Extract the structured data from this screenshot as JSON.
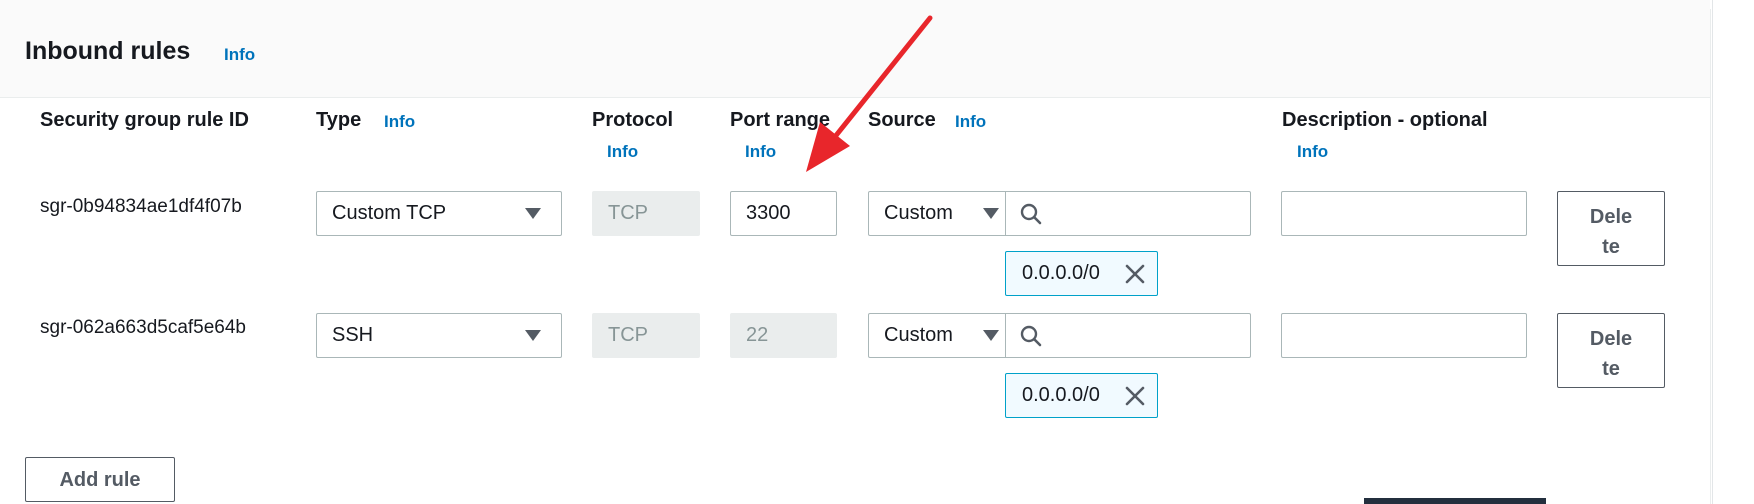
{
  "section": {
    "title": "Inbound rules",
    "info": "Info"
  },
  "columns": {
    "rule_id": "Security group rule ID",
    "type": "Type",
    "type_info": "Info",
    "protocol": "Protocol",
    "protocol_info": "Info",
    "port_range": "Port range",
    "port_range_info": "Info",
    "source": "Source",
    "source_info": "Info",
    "description": "Description - optional",
    "description_info": "Info"
  },
  "rules": [
    {
      "id": "sgr-0b94834ae1df4f07b",
      "type": "Custom TCP",
      "protocol": "TCP",
      "port_range": "3300",
      "source_mode": "Custom",
      "source_search": "",
      "source_token": "0.0.0.0/0",
      "description": "",
      "delete_label": "Delete"
    },
    {
      "id": "sgr-062a663d5caf5e64b",
      "type": "SSH",
      "protocol": "TCP",
      "port_range": "22",
      "source_mode": "Custom",
      "source_search": "",
      "source_token": "0.0.0.0/0",
      "description": "",
      "delete_label": "Delete"
    }
  ],
  "actions": {
    "add_rule": "Add rule"
  },
  "colors": {
    "link": "#0073bb",
    "token_border": "#00a1c9",
    "annotation_arrow": "#e8262b"
  },
  "icons": [
    "search-icon",
    "close-icon",
    "caret-down-icon",
    "annotation-arrow"
  ]
}
